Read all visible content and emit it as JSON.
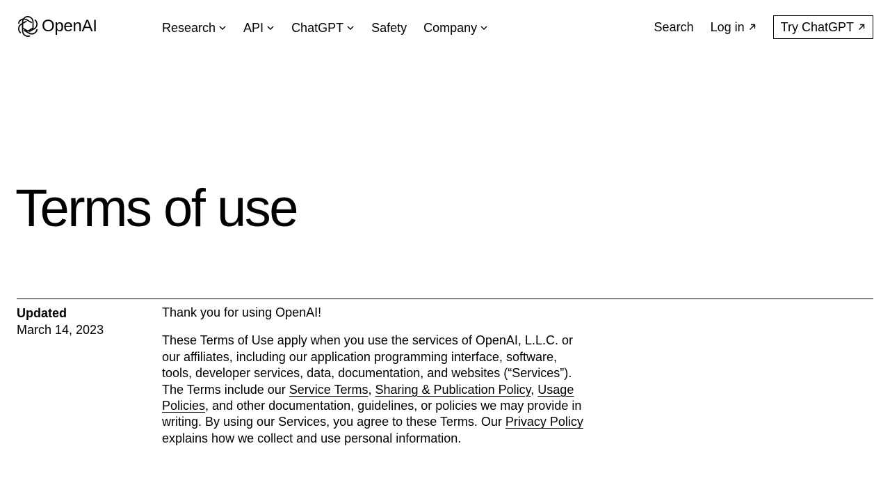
{
  "brand": {
    "name": "OpenAI",
    "logo_icon": "openai-flower-icon"
  },
  "nav": {
    "items": [
      {
        "label": "Research",
        "has_dropdown": true
      },
      {
        "label": "API",
        "has_dropdown": true
      },
      {
        "label": "ChatGPT",
        "has_dropdown": true
      },
      {
        "label": "Safety",
        "has_dropdown": false
      },
      {
        "label": "Company",
        "has_dropdown": true
      }
    ],
    "dropdown_icon": "chevron-down-icon"
  },
  "header_actions": {
    "search_label": "Search",
    "login_label": "Log in",
    "try_label": "Try ChatGPT",
    "external_icon": "arrow-up-right-icon"
  },
  "page": {
    "title": "Terms of use",
    "updated_label": "Updated",
    "updated_date": "March 14, 2023"
  },
  "content": {
    "greeting": "Thank you for using OpenAI!",
    "para_prefix": "These Terms of Use apply when you use the services of OpenAI, L.L.C. or our affiliates, including our application programming interface, software, tools, developer services, data, documentation, and websites (“Services”). The Terms include our ",
    "link_service_terms": "Service Terms",
    "sep_1": ", ",
    "link_sharing_policy": "Sharing & Publication Policy",
    "sep_2": ", ",
    "link_usage_policies": "Usage Policies",
    "para_middle": ", and other documentation, guidelines, or policies we may provide in writing. By using our Services, you agree to these Terms. Our ",
    "link_privacy_policy": "Privacy Policy",
    "para_suffix": " explains how we collect and use personal information."
  },
  "colors": {
    "background": "#ffffff",
    "text": "#000000"
  }
}
